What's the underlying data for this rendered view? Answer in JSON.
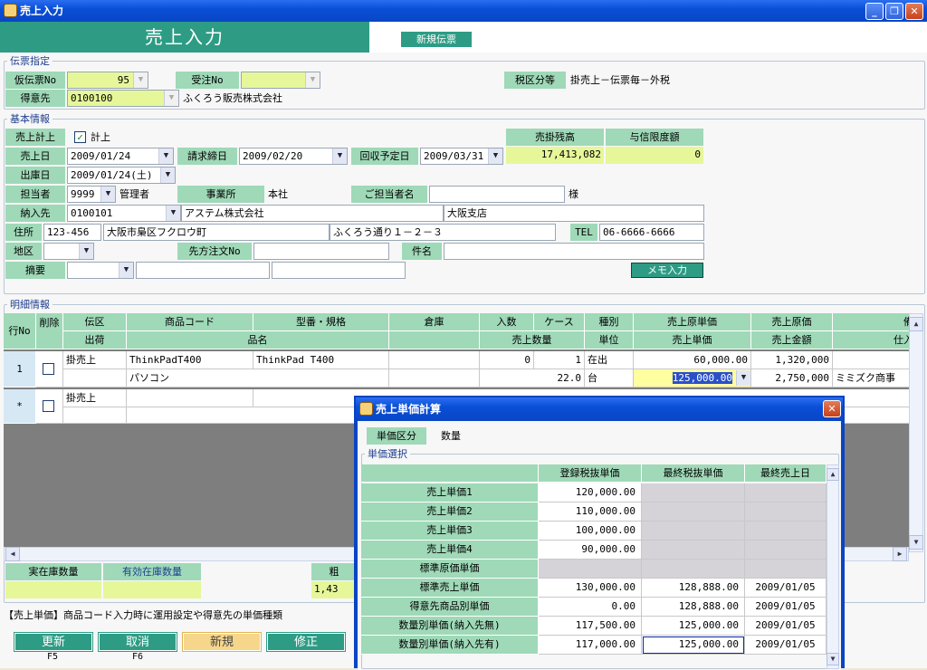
{
  "window": {
    "title": "売上入力"
  },
  "header": {
    "title": "売上入力",
    "new_slip_button": "新規伝票"
  },
  "slip": {
    "section": "伝票指定",
    "temp_no_label": "仮伝票No",
    "temp_no_value": "95",
    "order_no_label": "受注No",
    "order_no_value": "",
    "tax_label": "税区分等",
    "tax_value": "掛売上－伝票毎－外税",
    "customer_label": "得意先",
    "customer_code": "0100100",
    "customer_name": "ふくろう販売株式会社"
  },
  "basic": {
    "section": "基本情報",
    "record_label": "売上計上",
    "record_check": "✓",
    "record_text": "計上",
    "ar_balance_label": "売掛残高",
    "ar_balance_value": "17,413,082",
    "credit_limit_label": "与信限度額",
    "credit_limit_value": "0",
    "sales_date_label": "売上日",
    "sales_date_value": "2009/01/24",
    "billing_close_label": "請求締日",
    "billing_close_value": "2009/02/20",
    "collect_label": "回収予定日",
    "collect_value": "2009/03/31",
    "ship_date_label": "出庫日",
    "ship_date_value": "2009/01/24(土)",
    "staff_label": "担当者",
    "staff_code": "9999",
    "staff_name": "管理者",
    "office_label": "事業所",
    "office_value": "本社",
    "contact_label": "ご担当者名",
    "contact_value": "",
    "contact_suffix": "様",
    "delivery_label": "納入先",
    "delivery_code": "0100101",
    "delivery_name": "アステム株式会社",
    "delivery_branch": "大阪支店",
    "address_label": "住所",
    "zip": "123-456",
    "address1": "大阪市梟区フクロウ町",
    "address2": "ふくろう通り１－２－３",
    "tel_label": "TEL",
    "tel_value": "06-6666-6666",
    "area_label": "地区",
    "area_value": "",
    "client_order_label": "先方注文No",
    "client_order_value": "",
    "subject_label": "件名",
    "subject_value": "",
    "memo_label": "摘要",
    "memo_value": "",
    "memo_button": "メモ入力"
  },
  "detail": {
    "section": "明細情報",
    "headers1": [
      "行No",
      "削除",
      "伝区",
      "商品コード",
      "型番・規格",
      "倉庫",
      "入数",
      "ケース",
      "種別",
      "売上原単価",
      "売上原価",
      "備"
    ],
    "headers2": [
      "出荷",
      "品名",
      "売上数量",
      "単位",
      "売上単価",
      "売上金額",
      "仕入"
    ],
    "row1": {
      "no": "1",
      "slip_type": "掛売上",
      "code": "ThinkPadT400",
      "model": "ThinkPad T400",
      "qty_per": "0",
      "case": "1",
      "kind": "在出",
      "cost_unit": "60,000.00",
      "cost": "1,320,000",
      "name": "パソコン",
      "qty": "22.0",
      "unit": "台",
      "unit_price": "125,000.00",
      "amount": "2,750,000",
      "supplier": "ミミズク商事"
    },
    "row_new": {
      "no": "*",
      "slip_type": "掛売上"
    }
  },
  "stock": {
    "actual_label": "実在庫数量",
    "effective_label": "有効在庫数量",
    "gross_label": "粗",
    "gross_value": "1,43"
  },
  "status": {
    "message": "【売上単価】商品コード入力時に運用設定や得意先の単価種類"
  },
  "footer": {
    "update": "更新",
    "update_key": "F5",
    "cancel": "取消",
    "cancel_key": "F6",
    "new": "新規",
    "edit": "修正"
  },
  "dialog": {
    "title": "売上単価計算",
    "mode_label": "単価区分",
    "mode_value": "数量",
    "section": "単価選択",
    "headers": [
      "登録税抜単価",
      "最終税抜単価",
      "最終売上日"
    ],
    "rows": [
      {
        "label": "売上単価1",
        "reg": "120,000.00",
        "last": "",
        "date": ""
      },
      {
        "label": "売上単価2",
        "reg": "110,000.00",
        "last": "",
        "date": ""
      },
      {
        "label": "売上単価3",
        "reg": "100,000.00",
        "last": "",
        "date": ""
      },
      {
        "label": "売上単価4",
        "reg": "90,000.00",
        "last": "",
        "date": ""
      },
      {
        "label": "標準原価単価",
        "reg": "",
        "last": "",
        "date": ""
      },
      {
        "label": "標準売上単価",
        "reg": "130,000.00",
        "last": "128,888.00",
        "date": "2009/01/05"
      },
      {
        "label": "得意先商品別単価",
        "reg": "0.00",
        "last": "128,888.00",
        "date": "2009/01/05"
      },
      {
        "label": "数量別単価(納入先無)",
        "reg": "117,500.00",
        "last": "125,000.00",
        "date": "2009/01/05"
      },
      {
        "label": "数量別単価(納入先有)",
        "reg": "117,000.00",
        "last": "125,000.00",
        "date": "2009/01/05"
      }
    ]
  }
}
